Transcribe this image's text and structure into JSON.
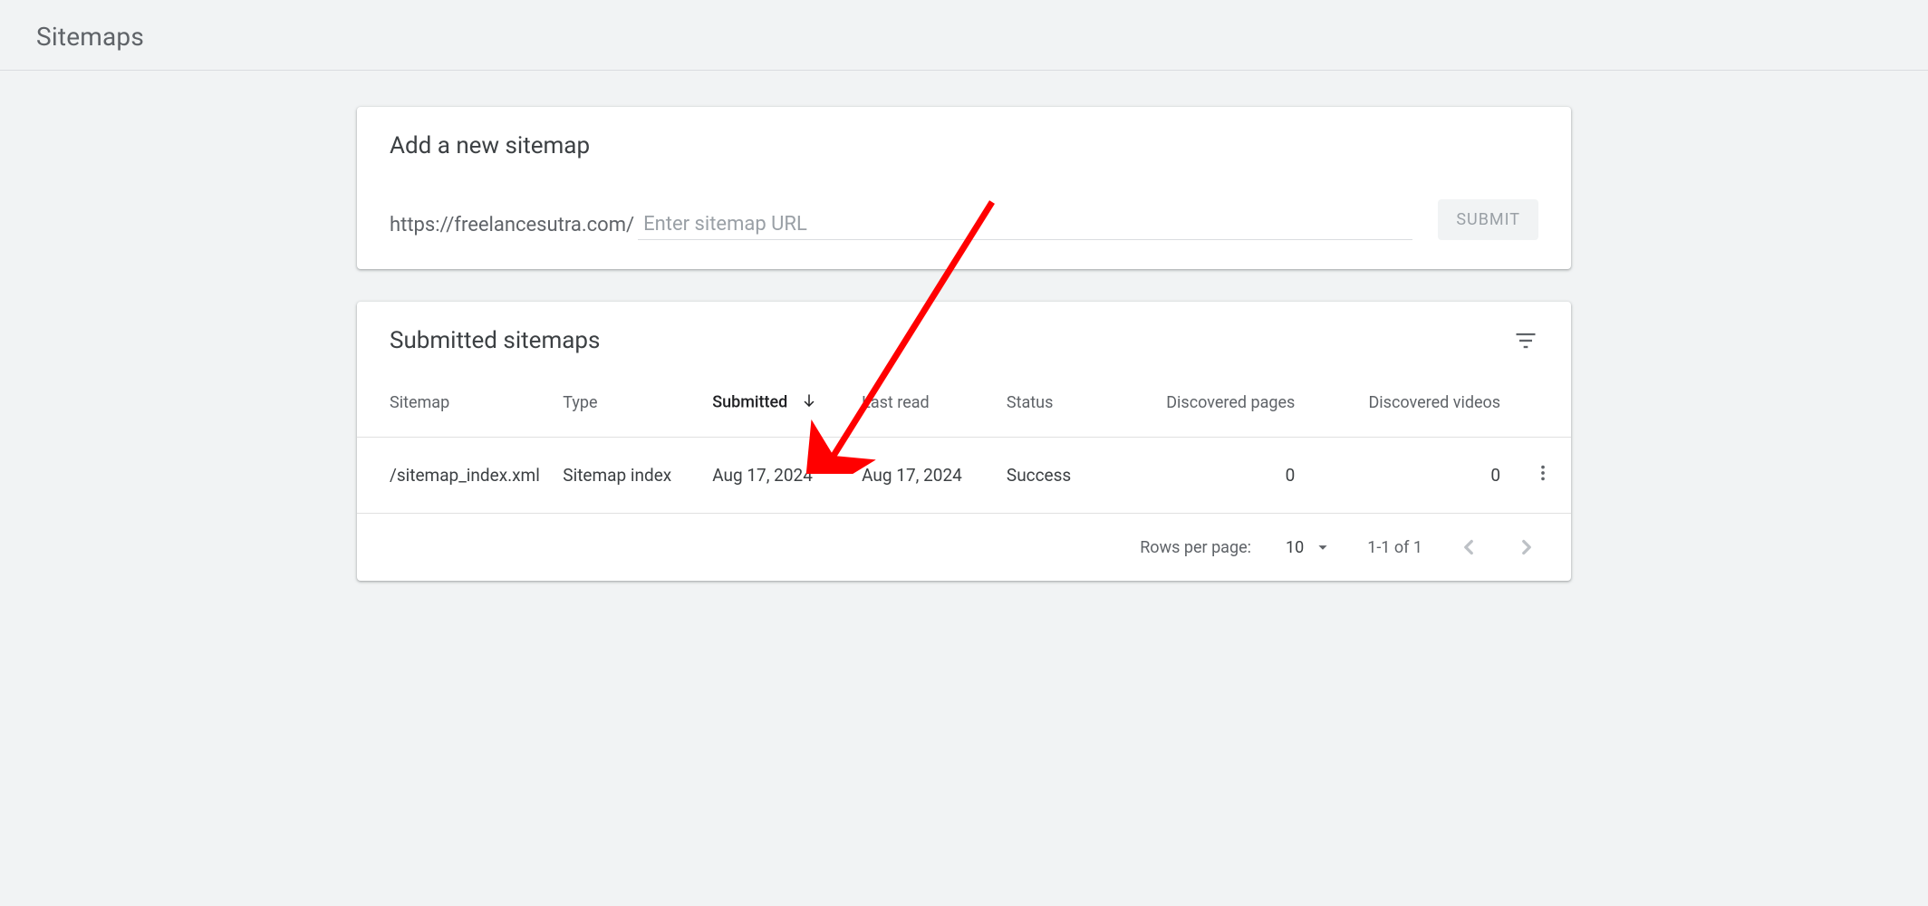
{
  "header": {
    "title": "Sitemaps"
  },
  "addCard": {
    "title": "Add a new sitemap",
    "urlPrefix": "https://freelancesutra.com/",
    "placeholder": "Enter sitemap URL",
    "submitLabel": "SUBMIT"
  },
  "submittedCard": {
    "title": "Submitted sitemaps",
    "columns": {
      "sitemap": "Sitemap",
      "type": "Type",
      "submitted": "Submitted",
      "lastRead": "Last read",
      "status": "Status",
      "discoveredPages": "Discovered pages",
      "discoveredVideos": "Discovered videos"
    },
    "rows": [
      {
        "sitemap": "/sitemap_index.xml",
        "type": "Sitemap index",
        "submitted": "Aug 17, 2024",
        "lastRead": "Aug 17, 2024",
        "status": "Success",
        "discoveredPages": "0",
        "discoveredVideos": "0"
      }
    ],
    "footer": {
      "rowsPerPageLabel": "Rows per page:",
      "rowsPerPageValue": "10",
      "rangeLabel": "1-1 of 1"
    }
  }
}
